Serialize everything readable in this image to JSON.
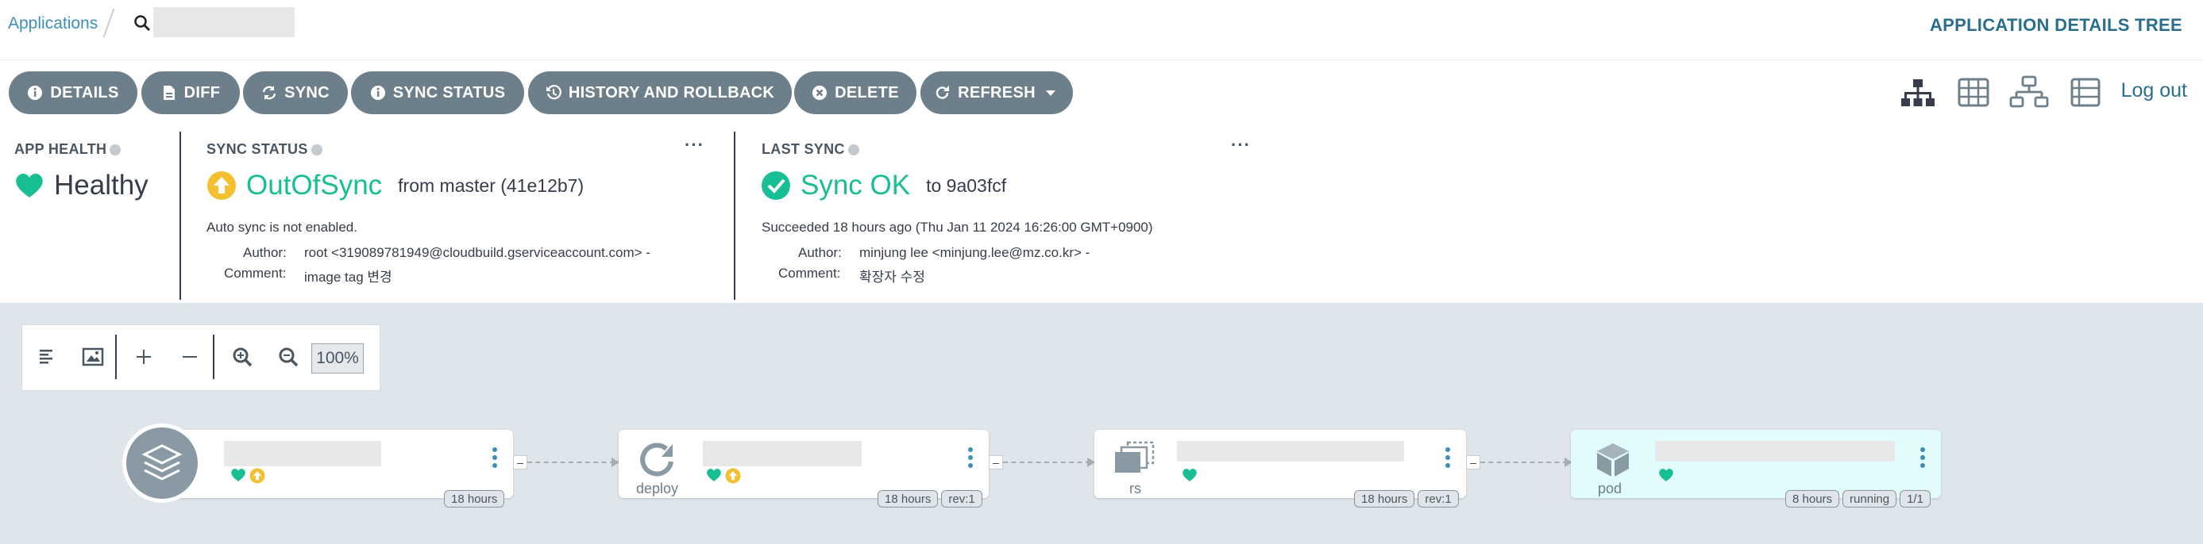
{
  "header": {
    "breadcrumb_applications": "Applications",
    "view_title": "APPLICATION DETAILS TREE"
  },
  "toolbar": {
    "buttons": [
      {
        "label": "DETAILS",
        "icon": "info-circle-icon"
      },
      {
        "label": "DIFF",
        "icon": "file-icon"
      },
      {
        "label": "SYNC",
        "icon": "sync-icon"
      },
      {
        "label": "SYNC STATUS",
        "icon": "info-circle-icon"
      },
      {
        "label": "HISTORY AND ROLLBACK",
        "icon": "history-icon"
      },
      {
        "label": "DELETE",
        "icon": "times-circle-icon"
      },
      {
        "label": "REFRESH",
        "icon": "redo-icon"
      }
    ],
    "logout": "Log out"
  },
  "app_health": {
    "label": "APP HEALTH",
    "status": "Healthy",
    "color": "#18be94"
  },
  "sync_status": {
    "label": "SYNC STATUS",
    "status": "OutOfSync",
    "from": "from master (41e12b7)",
    "auto_sync": "Auto sync is not enabled.",
    "author_label": "Author:",
    "author": "root <319089781949@cloudbuild.gserviceaccount.com> -",
    "comment_label": "Comment:",
    "comment": "image tag 변경",
    "color": "#f4c030"
  },
  "last_sync": {
    "label": "LAST SYNC",
    "status": "Sync OK",
    "to": "to 9a03fcf",
    "succeeded": "Succeeded 18 hours ago (Thu Jan 11 2024 16:26:00 GMT+0900)",
    "author_label": "Author:",
    "author": "minjung lee <minjung.lee@mz.co.kr> -",
    "comment_label": "Comment:",
    "comment": "확장자 수정",
    "color": "#18be94"
  },
  "zoom": {
    "level": "100%"
  },
  "nodes": [
    {
      "kind": "",
      "tags": [
        "18 hours"
      ]
    },
    {
      "kind": "deploy",
      "tags": [
        "18 hours",
        "rev:1"
      ]
    },
    {
      "kind": "rs",
      "tags": [
        "18 hours",
        "rev:1"
      ]
    },
    {
      "kind": "pod",
      "tags": [
        "8 hours",
        "running",
        "1/1"
      ]
    }
  ]
}
